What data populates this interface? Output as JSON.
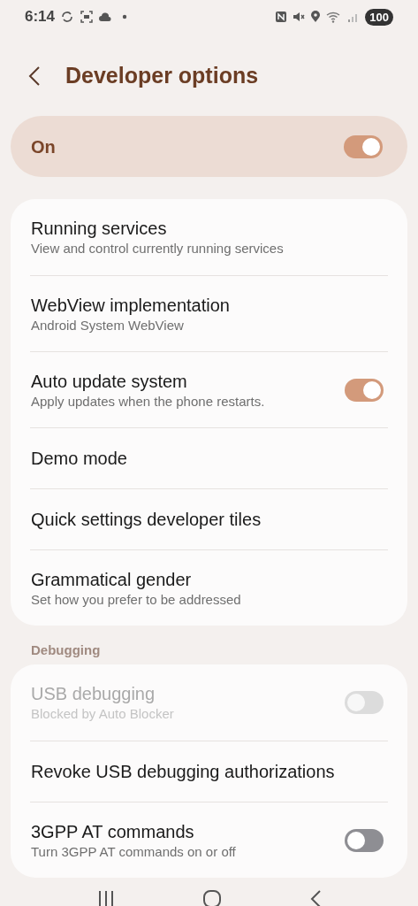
{
  "status_bar": {
    "time": "6:14",
    "battery": "100"
  },
  "header": {
    "title": "Developer options"
  },
  "master_switch": {
    "label": "On",
    "on": true
  },
  "sections": [
    {
      "items": [
        {
          "kind": "plain",
          "title": "Running services",
          "subtitle": "View and control currently running services"
        },
        {
          "kind": "plain",
          "title": "WebView implementation",
          "subtitle": "Android System WebView"
        },
        {
          "kind": "toggle",
          "title": "Auto update system",
          "subtitle": "Apply updates when the phone restarts.",
          "on": true,
          "disabled": false
        },
        {
          "kind": "plain",
          "title": "Demo mode"
        },
        {
          "kind": "plain",
          "title": "Quick settings developer tiles"
        },
        {
          "kind": "plain",
          "title": "Grammatical gender",
          "subtitle": "Set how you prefer to be addressed"
        }
      ]
    },
    {
      "heading": "Debugging",
      "items": [
        {
          "kind": "toggle",
          "title": "USB debugging",
          "subtitle": "Blocked by Auto Blocker",
          "on": false,
          "disabled": true
        },
        {
          "kind": "plain",
          "title": "Revoke USB debugging authorizations"
        },
        {
          "kind": "toggle",
          "title": "3GPP AT commands",
          "subtitle": "Turn 3GPP AT commands on or off",
          "on": false,
          "disabled": false
        }
      ]
    }
  ]
}
